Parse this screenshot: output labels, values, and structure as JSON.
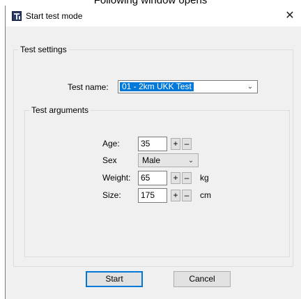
{
  "page_caption": "Following window opens",
  "window": {
    "title": "Start test mode",
    "close_glyph": "✕"
  },
  "test_settings": {
    "title": "Test settings",
    "test_name_label": "Test name:",
    "test_name_value": "01 - 2km UKK Test"
  },
  "test_arguments": {
    "title": "Test arguments",
    "age": {
      "label": "Age:",
      "value": "35"
    },
    "sex": {
      "label": "Sex",
      "value": "Male"
    },
    "weight": {
      "label": "Weight:",
      "value": "65",
      "unit": "kg"
    },
    "size": {
      "label": "Size:",
      "value": "175",
      "unit": "cm"
    },
    "plus_glyph": "+",
    "minus_glyph": "–"
  },
  "buttons": {
    "start": "Start",
    "cancel": "Cancel"
  },
  "icons": {
    "app": "app-window-icon",
    "close": "close-icon",
    "dropdown": "chevron-down-icon",
    "increment": "plus-icon",
    "decrement": "minus-icon"
  }
}
